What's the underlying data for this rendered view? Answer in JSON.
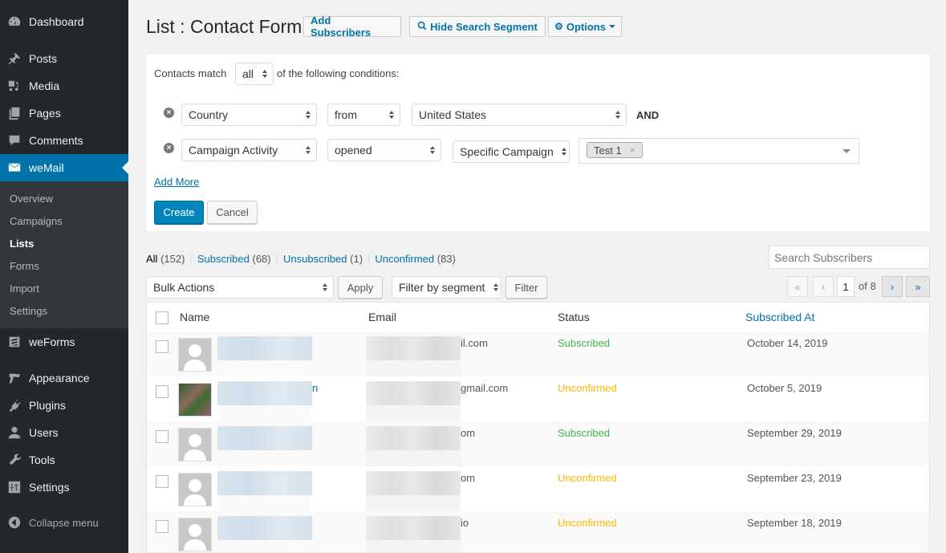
{
  "sidebar": {
    "items": [
      {
        "label": "Dashboard",
        "icon": "dashboard-icon"
      },
      {
        "label": "Posts",
        "icon": "pin-icon"
      },
      {
        "label": "Media",
        "icon": "media-icon"
      },
      {
        "label": "Pages",
        "icon": "pages-icon"
      },
      {
        "label": "Comments",
        "icon": "comment-icon"
      },
      {
        "label": "weMail",
        "icon": "envelope-icon",
        "active": true
      },
      {
        "label": "weForms",
        "icon": "weforms-icon"
      },
      {
        "label": "Appearance",
        "icon": "paintbrush-icon"
      },
      {
        "label": "Plugins",
        "icon": "plug-icon"
      },
      {
        "label": "Users",
        "icon": "user-icon"
      },
      {
        "label": "Tools",
        "icon": "wrench-icon"
      },
      {
        "label": "Settings",
        "icon": "sliders-icon"
      }
    ],
    "submenu": [
      "Overview",
      "Campaigns",
      "Lists",
      "Forms",
      "Import",
      "Settings"
    ],
    "submenu_current": "Lists",
    "collapse_label": "Collapse menu"
  },
  "header": {
    "title": "List : Contact Form",
    "add_subscribers": "Add Subscribers",
    "hide_search": "Hide Search Segment",
    "options": "Options"
  },
  "segment": {
    "match_prefix": "Contacts match",
    "match_value": "all",
    "match_suffix": "of the following conditions:",
    "conditions": [
      {
        "field": "Country",
        "operator": "from",
        "value": "United States",
        "joiner": "AND"
      },
      {
        "field": "Campaign Activity",
        "operator": "opened",
        "value": "Specific Campaign",
        "tags": [
          "Test 1"
        ]
      }
    ],
    "add_more": "Add More",
    "create": "Create",
    "cancel": "Cancel"
  },
  "views": {
    "all": {
      "label": "All",
      "count": "(152)"
    },
    "subscribed": {
      "label": "Subscribed",
      "count": "(68)"
    },
    "unsubscribed": {
      "label": "Unsubscribed",
      "count": "(1)"
    },
    "unconfirmed": {
      "label": "Unconfirmed",
      "count": "(83)"
    }
  },
  "toolbar": {
    "search_placeholder": "Search Subscribers",
    "bulk_actions": "Bulk Actions",
    "apply": "Apply",
    "filter_segment": "Filter by segment",
    "filter": "Filter",
    "pagination": {
      "first": "«",
      "prev": "‹",
      "current": "1",
      "of": "of 8",
      "next": "›",
      "last": "»"
    }
  },
  "table": {
    "columns": [
      "Name",
      "Email",
      "Status",
      "Subscribed At"
    ],
    "rows": [
      {
        "name_visible": "",
        "email_visible": "il.com",
        "status": "Subscribed",
        "date": "October 14, 2019"
      },
      {
        "name_visible": "n",
        "email_visible": "gmail.com",
        "status": "Unconfirmed",
        "date": "October 5, 2019"
      },
      {
        "name_visible": "",
        "email_visible": "om",
        "status": "Subscribed",
        "date": "September 29, 2019"
      },
      {
        "name_visible": "",
        "email_visible": "om",
        "status": "Unconfirmed",
        "date": "September 23, 2019"
      },
      {
        "name_visible": "",
        "email_visible": "io",
        "status": "Unconfirmed",
        "date": "September 18, 2019"
      }
    ]
  },
  "colors": {
    "accent": "#0073aa",
    "sidebar_bg": "#23282d",
    "submenu_bg": "#32373c",
    "subscribed": "#46b450",
    "unconfirmed": "#ffb900",
    "primary_button": "#0085ba"
  }
}
